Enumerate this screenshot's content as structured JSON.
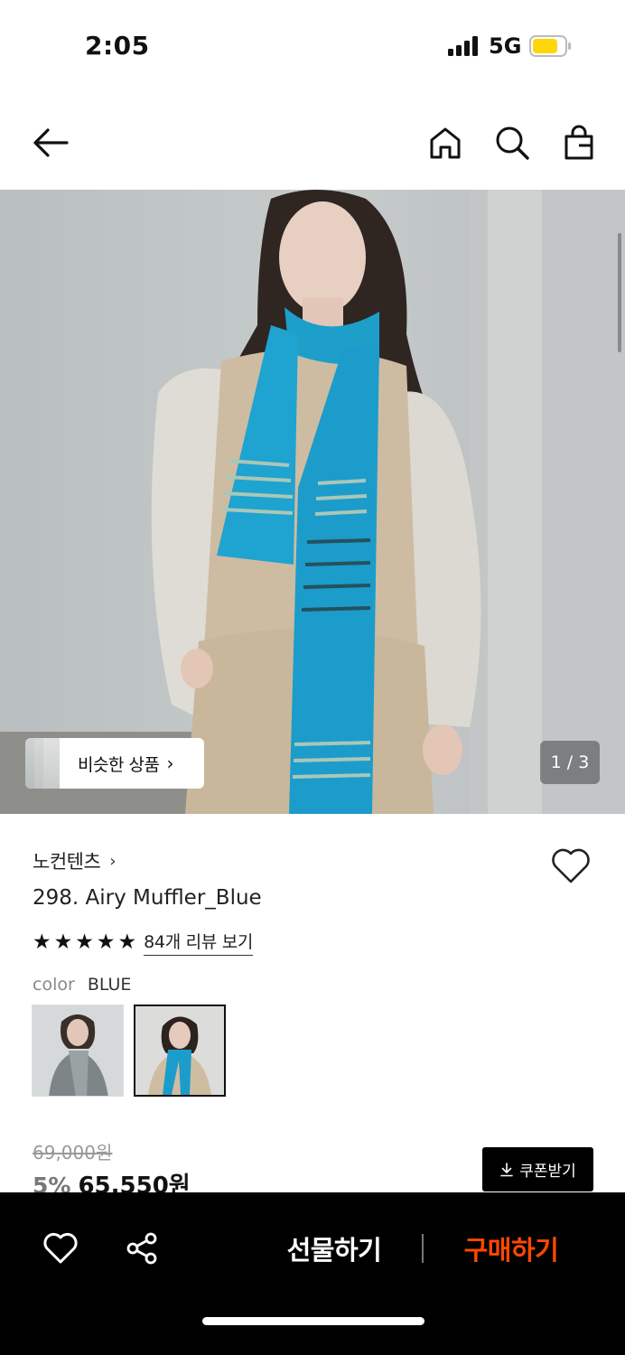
{
  "status": {
    "time": "2:05",
    "network": "5G",
    "battery_color": "#FFD60A"
  },
  "nav": {
    "back_icon": "arrow-left-icon",
    "home_icon": "home-icon",
    "search_icon": "search-icon",
    "cart_icon": "shopping-bag-icon"
  },
  "gallery": {
    "similar_label": "비슷한 상품",
    "page_indicator": "1 / 3"
  },
  "product": {
    "brand": "노컨텐츠",
    "name": "298. Airy Muffler_Blue",
    "rating_stars": 5,
    "review_link": "84개 리뷰 보기",
    "option_label": "color",
    "option_value": "BLUE",
    "original_price": "69,000원",
    "discount": "5%",
    "sale_price": "65,550원",
    "coupon_label": "쿠폰받기"
  },
  "bottom": {
    "gift_label": "선물하기",
    "buy_label": "구매하기",
    "buy_color": "#FF4800"
  }
}
